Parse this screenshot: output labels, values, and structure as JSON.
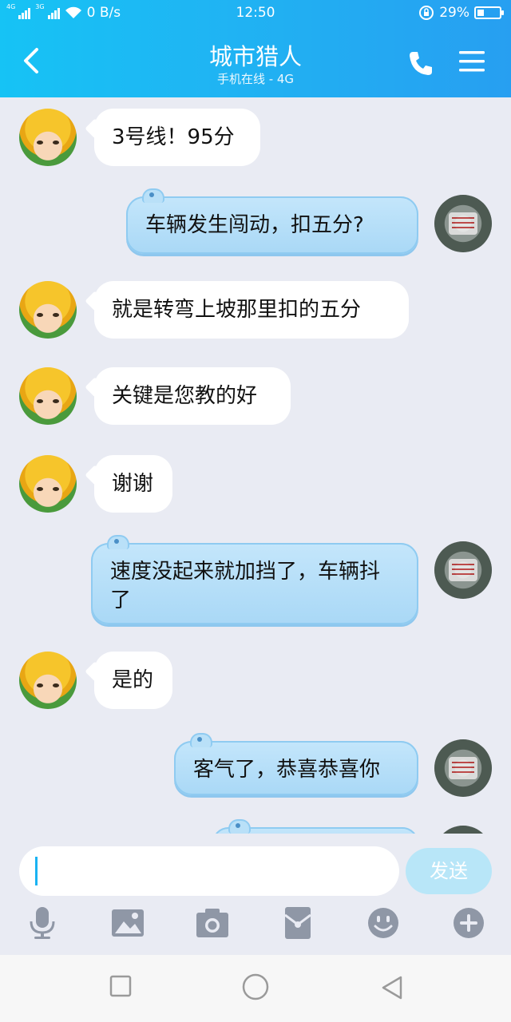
{
  "status_bar": {
    "net_label_1": "4G",
    "net_label_2": "3G",
    "speed": "0 B/s",
    "time": "12:50",
    "battery": "29%",
    "battery_level": 0.29
  },
  "header": {
    "title": "城市猎人",
    "subtitle": "手机在线 - 4G"
  },
  "messages": [
    {
      "side": "left",
      "text": "3号线！95分"
    },
    {
      "side": "right",
      "text": "车辆发生闯动，扣五分?"
    },
    {
      "side": "left",
      "text": "就是转弯上坡那里扣的五分"
    },
    {
      "side": "left",
      "text": "关键是您教的好"
    },
    {
      "side": "left",
      "text": "谢谢"
    },
    {
      "side": "right",
      "text": "速度没起来就加挡了，车辆抖了"
    },
    {
      "side": "left",
      "text": "是的"
    },
    {
      "side": "right",
      "text": "客气了，恭喜恭喜你"
    }
  ],
  "composer": {
    "input_value": "",
    "send_label": "发送"
  },
  "toolbar": [
    "mic-icon",
    "image-icon",
    "camera-icon",
    "red-packet-icon",
    "emoji-icon",
    "plus-icon"
  ],
  "colors": {
    "header_start": "#16c3f5",
    "header_end": "#279ff1",
    "chat_bg": "#e9ebf3",
    "my_bubble": "#b4dcf6",
    "send_button": "#b8e6f8"
  }
}
